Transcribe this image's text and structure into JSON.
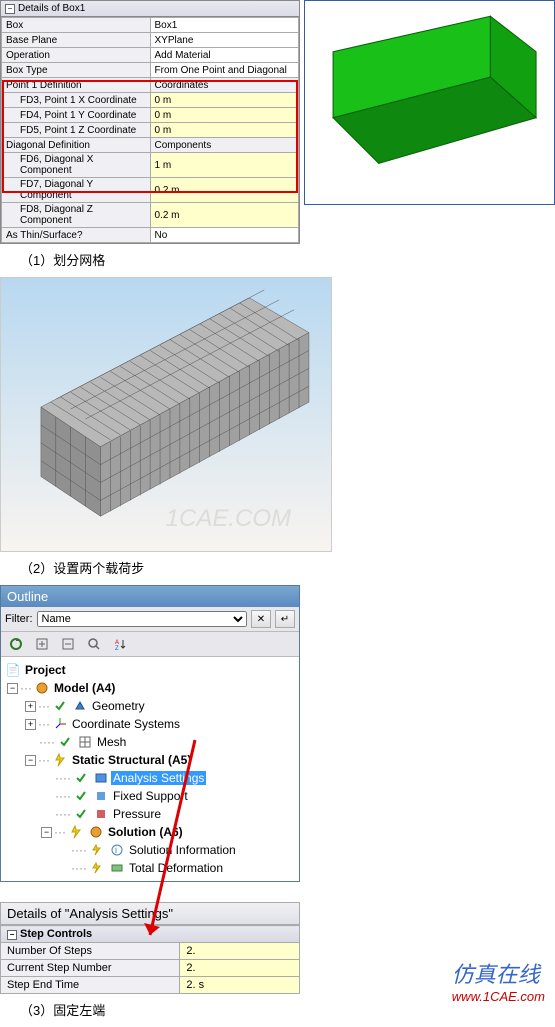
{
  "details_panel": {
    "title": "Details of Box1",
    "rows": [
      {
        "label": "Box",
        "value": "Box1"
      },
      {
        "label": "Base Plane",
        "value": "XYPlane"
      },
      {
        "label": "Operation",
        "value": "Add Material"
      },
      {
        "label": "Box Type",
        "value": "From One Point and Diagonal"
      },
      {
        "label": "Point 1 Definition",
        "value": "Coordinates"
      },
      {
        "label": "FD3, Point 1 X Coordinate",
        "value": "0 m"
      },
      {
        "label": "FD4, Point 1 Y Coordinate",
        "value": "0 m"
      },
      {
        "label": "FD5, Point 1 Z Coordinate",
        "value": "0 m"
      },
      {
        "label": "Diagonal Definition",
        "value": "Components"
      },
      {
        "label": "FD6, Diagonal X Component",
        "value": "1 m"
      },
      {
        "label": "FD7, Diagonal Y Component",
        "value": "0.2 m"
      },
      {
        "label": "FD8, Diagonal Z Component",
        "value": "0.2 m"
      },
      {
        "label": "As Thin/Surface?",
        "value": "No"
      }
    ]
  },
  "captions": {
    "c1": "（1）划分网格",
    "c2": "（2）设置两个载荷步",
    "c3": "（3）固定左端"
  },
  "watermark": "1CAE.COM",
  "outline": {
    "header": "Outline",
    "filter_label": "Filter:",
    "filter_value": "Name",
    "tree": {
      "project": "Project",
      "model": "Model (A4)",
      "geometry": "Geometry",
      "coord": "Coordinate Systems",
      "mesh": "Mesh",
      "static": "Static Structural (A5)",
      "analysis": "Analysis Settings",
      "fixed": "Fixed Support",
      "pressure": "Pressure",
      "solution": "Solution (A6)",
      "solinfo": "Solution Information",
      "totaldef": "Total Deformation"
    }
  },
  "details2": {
    "header": "Details of \"Analysis Settings\"",
    "group": "Step Controls",
    "rows": [
      {
        "label": "Number Of Steps",
        "value": "2."
      },
      {
        "label": "Current Step Number",
        "value": "2."
      },
      {
        "label": "Step End Time",
        "value": "2. s"
      }
    ]
  },
  "footer": {
    "cn": "仿真在线",
    "url": "www.1CAE.com"
  }
}
